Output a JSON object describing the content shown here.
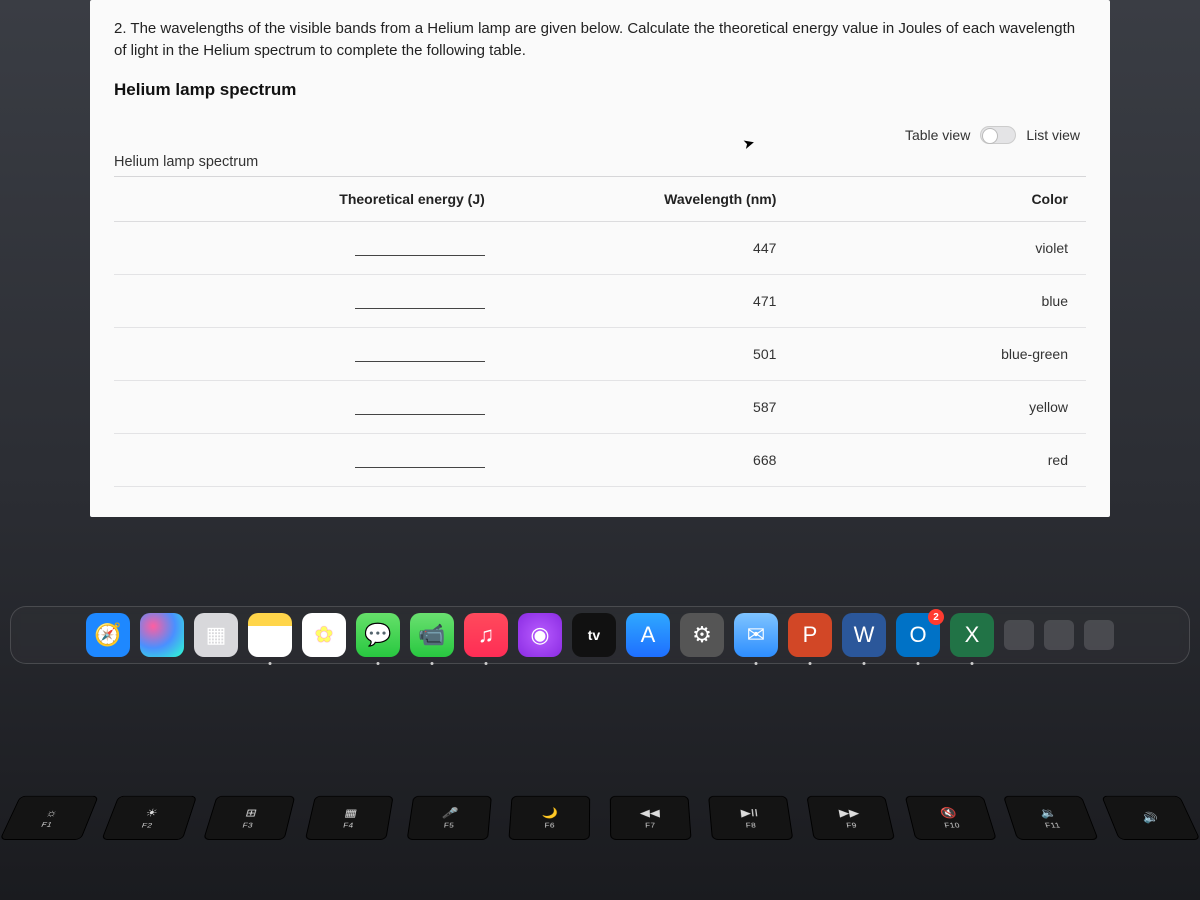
{
  "question": {
    "prompt": "2. The wavelengths of the visible bands from a Helium lamp are given below. Calculate the theoretical energy value in Joules of each wavelength of light in the Helium spectrum to complete the following table.",
    "heading": "Helium lamp spectrum",
    "caption": "Helium lamp spectrum"
  },
  "view_toggle": {
    "left_label": "Table view",
    "right_label": "List view",
    "state": "table"
  },
  "table": {
    "columns": {
      "energy": "Theoretical energy (J)",
      "wavelength": "Wavelength (nm)",
      "color": "Color"
    },
    "rows": [
      {
        "energy": "",
        "wavelength": "447",
        "color": "violet"
      },
      {
        "energy": "",
        "wavelength": "471",
        "color": "blue"
      },
      {
        "energy": "",
        "wavelength": "501",
        "color": "blue-green"
      },
      {
        "energy": "",
        "wavelength": "587",
        "color": "yellow"
      },
      {
        "energy": "",
        "wavelength": "668",
        "color": "red"
      }
    ]
  },
  "dock": {
    "items": [
      {
        "name": "safari",
        "glyph": "🧭",
        "running": false
      },
      {
        "name": "siri",
        "glyph": "",
        "running": false
      },
      {
        "name": "launchpad",
        "glyph": "▦",
        "running": false
      },
      {
        "name": "notes",
        "glyph": "",
        "running": true
      },
      {
        "name": "photos",
        "glyph": "✿",
        "running": false
      },
      {
        "name": "messages",
        "glyph": "💬",
        "running": true
      },
      {
        "name": "facetime",
        "glyph": "📹",
        "running": true
      },
      {
        "name": "music",
        "glyph": "♫",
        "running": true
      },
      {
        "name": "podcasts",
        "glyph": "◉",
        "running": false
      },
      {
        "name": "tv",
        "glyph": "tv",
        "running": false
      },
      {
        "name": "appstore",
        "glyph": "A",
        "running": false
      },
      {
        "name": "settings",
        "glyph": "⚙",
        "running": false
      },
      {
        "name": "mail",
        "glyph": "✉",
        "running": true
      },
      {
        "name": "powerpoint",
        "glyph": "P",
        "running": true
      },
      {
        "name": "word",
        "glyph": "W",
        "running": true
      },
      {
        "name": "outlook",
        "glyph": "O",
        "running": true,
        "badge": "2"
      },
      {
        "name": "excel",
        "glyph": "X",
        "running": true
      }
    ]
  },
  "keyboard": {
    "row1": [
      {
        "glyph": "☼",
        "label": "F1"
      },
      {
        "glyph": "☀",
        "label": "F2"
      },
      {
        "glyph": "⊞",
        "label": "F3"
      },
      {
        "glyph": "▦",
        "label": "F4"
      },
      {
        "glyph": "🎤",
        "label": "F5"
      },
      {
        "glyph": "🌙",
        "label": "F6"
      },
      {
        "glyph": "◀◀",
        "label": "F7"
      },
      {
        "glyph": "▶II",
        "label": "F8"
      },
      {
        "glyph": "▶▶",
        "label": "F9"
      },
      {
        "glyph": "🔇",
        "label": "F10"
      },
      {
        "glyph": "🔉",
        "label": "F11"
      },
      {
        "glyph": "🔊",
        "label": ""
      }
    ]
  },
  "chart_data": {
    "type": "table",
    "title": "Helium lamp spectrum",
    "columns": [
      "Theoretical energy (J)",
      "Wavelength (nm)",
      "Color"
    ],
    "rows": [
      [
        null,
        447,
        "violet"
      ],
      [
        null,
        471,
        "blue"
      ],
      [
        null,
        501,
        "blue-green"
      ],
      [
        null,
        587,
        "yellow"
      ],
      [
        null,
        668,
        "red"
      ]
    ]
  }
}
